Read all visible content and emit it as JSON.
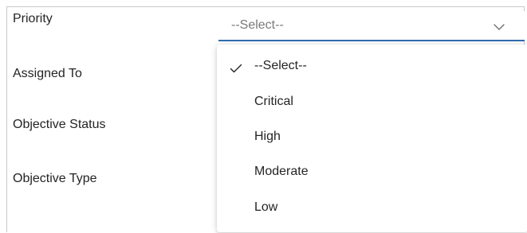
{
  "form": {
    "fields": [
      {
        "label": "Priority"
      },
      {
        "label": "Assigned To"
      },
      {
        "label": "Objective Status"
      },
      {
        "label": "Objective Type"
      }
    ]
  },
  "priority_select": {
    "value": "--Select--",
    "chevron_icon": "chevron-down-icon",
    "options": [
      {
        "label": "--Select--",
        "selected": true
      },
      {
        "label": "Critical",
        "selected": false
      },
      {
        "label": "High",
        "selected": false
      },
      {
        "label": "Moderate",
        "selected": false
      },
      {
        "label": "Low",
        "selected": false
      }
    ]
  },
  "colors": {
    "focus_underline": "#2f6fb3",
    "placeholder_text": "#7a7a7a",
    "label_text": "#242424"
  }
}
